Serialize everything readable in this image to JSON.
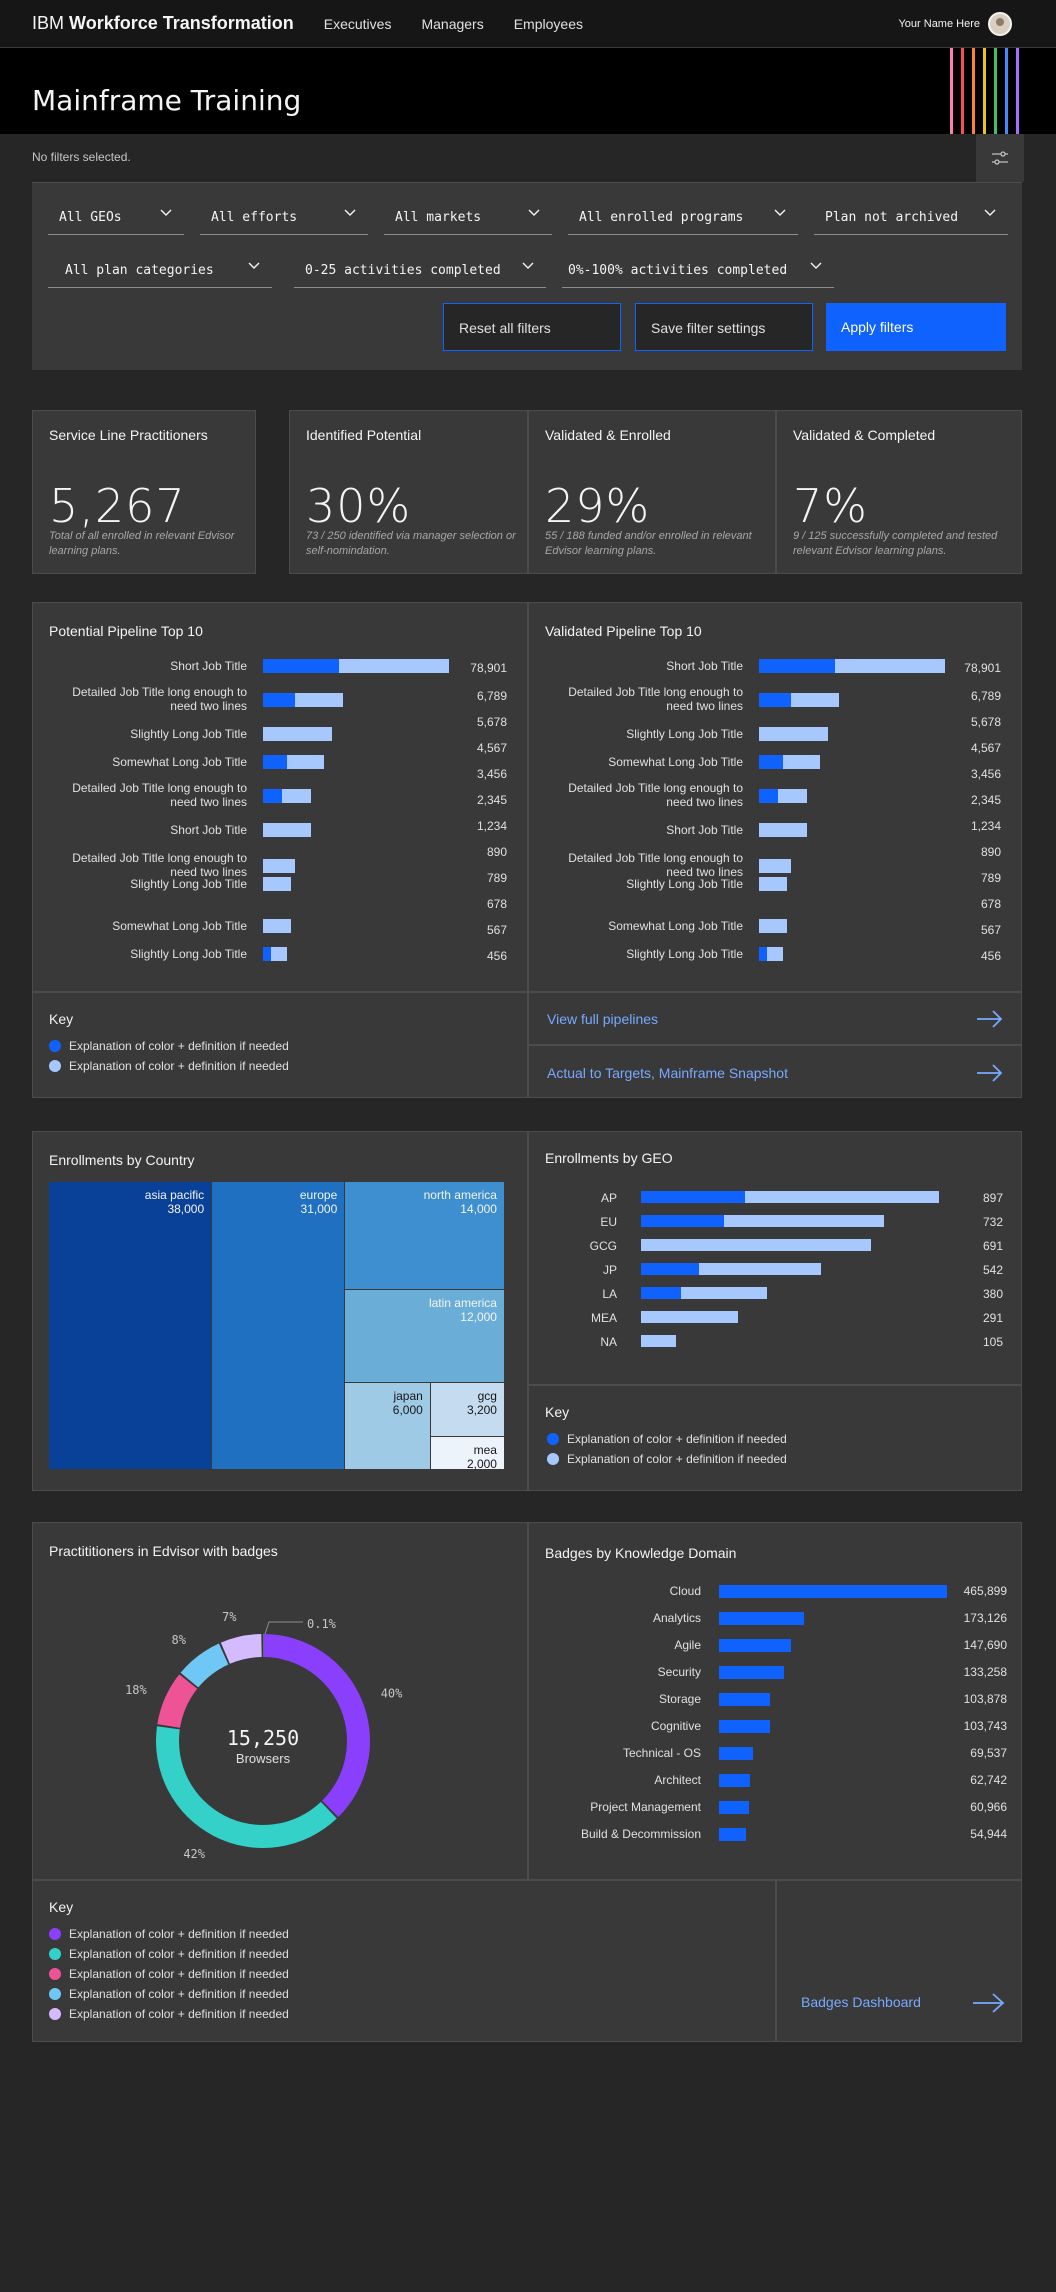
{
  "app": {
    "brand_prefix": "IBM",
    "brand_name": "Workforce Transformation"
  },
  "nav": {
    "items": [
      "Executives",
      "Managers",
      "Employees"
    ]
  },
  "user": {
    "name": "Your Name Here"
  },
  "page": {
    "title": "Mainframe Training",
    "stripe_colors": [
      "#ff7eb6",
      "#fa4d56",
      "#ff832b",
      "#f1c21b",
      "#42be65",
      "#4589ff",
      "#a56eff"
    ]
  },
  "filters": {
    "status": "No filters selected.",
    "dropdowns_row1": [
      "All GEOs",
      "All efforts",
      "All markets",
      "All enrolled programs",
      "Plan not archived"
    ],
    "dropdowns_row2": [
      "All plan categories",
      "0-25 activities completed",
      "0%-100% activities completed"
    ],
    "reset_label": "Reset all filters",
    "save_label": "Save filter settings",
    "apply_label": "Apply filters"
  },
  "kpis": [
    {
      "title": "Service Line Practitioners",
      "value": "5,267",
      "note": "Total of all enrolled in relevant Edvisor learning plans."
    },
    {
      "title": "Identified Potential",
      "value": "30%",
      "note": "73 / 250 identified via manager selection or self-nomindation."
    },
    {
      "title": "Validated & Enrolled",
      "value": "29%",
      "note": "55 / 188 funded and/or enrolled in relevant Edvisor learning plans."
    },
    {
      "title": "Validated & Completed",
      "value": "7%",
      "note": "9 / 125 successfully completed and tested relevant Edvisor learning plans."
    }
  ],
  "pipelines": {
    "potential_title": "Potential Pipeline Top 10",
    "validated_title": "Validated Pipeline Top 10",
    "labels": [
      "Short Job Title",
      "Detailed Job Title long enough to need two lines",
      "Slightly Long Job Title",
      "Somewhat Long Job Title",
      "Detailed Job Title long enough to need two lines",
      "Short Job Title",
      "Detailed Job Title long enough to need two lines",
      "Slightly Long Job Title",
      "Somewhat Long Job Title",
      "Slightly Long Job Title"
    ],
    "values": [
      "78,901",
      "6,789",
      "5,678",
      "4,567",
      "3,456",
      "2,345",
      "1,234",
      "890",
      "789",
      "678",
      "567",
      "456"
    ],
    "dark_fraction": [
      0.41,
      0.4,
      0,
      0.39,
      0.39,
      0,
      0,
      0,
      0,
      0.33
    ],
    "bar_fraction": [
      1,
      0.43,
      0.37,
      0.33,
      0.26,
      0.26,
      0.17,
      0.15,
      0.15,
      0.13
    ]
  },
  "key": {
    "title": "Key",
    "two_items": [
      "Explanation of color + definition if needed",
      "Explanation of color + definition if needed"
    ],
    "colors_two": [
      "#0f62fe",
      "#a6c8ff"
    ]
  },
  "links": {
    "full_pipelines": "View full pipelines",
    "snapshot": "Actual to Targets, Mainframe Snapshot",
    "badges_dashboard": "Badges Dashboard"
  },
  "country": {
    "title": "Enrollments by Country",
    "cells": [
      {
        "name": "asia pacific",
        "value": "38,000",
        "color": "#0a4198"
      },
      {
        "name": "europe",
        "value": "31,000",
        "color": "#1f70c1"
      },
      {
        "name": "north america",
        "value": "14,000",
        "color": "#3d8fd0"
      },
      {
        "name": "latin america",
        "value": "12,000",
        "color": "#6aaed8"
      },
      {
        "name": "japan",
        "value": "6,000",
        "color": "#9ecae6"
      },
      {
        "name": "gcg",
        "value": "3,200",
        "color": "#c5dcf0"
      },
      {
        "name": "mea",
        "value": "2,000",
        "color": "#edf3fb"
      }
    ]
  },
  "geo": {
    "title": "Enrollments by GEO",
    "rows": [
      {
        "label": "AP",
        "value": "897",
        "total": 897,
        "dark": 0.35
      },
      {
        "label": "EU",
        "value": "732",
        "total": 732,
        "dark": 0.34
      },
      {
        "label": "GCG",
        "value": "691",
        "total": 691,
        "dark": 0
      },
      {
        "label": "JP",
        "value": "542",
        "total": 542,
        "dark": 0.32
      },
      {
        "label": "LA",
        "value": "380",
        "total": 380,
        "dark": 0.32
      },
      {
        "label": "MEA",
        "value": "291",
        "total": 291,
        "dark": 0
      },
      {
        "label": "NA",
        "value": "105",
        "total": 105,
        "dark": 0
      }
    ]
  },
  "badges": {
    "donut_title": "Practititioners in Edvisor with badges",
    "center_value": "15,250",
    "center_label": "Browsers",
    "slices": [
      {
        "label": "40%",
        "value": 40,
        "color": "#8a3ffc"
      },
      {
        "label": "42%",
        "value": 42,
        "color": "#33d1c8"
      },
      {
        "label": "18%",
        "value": 9,
        "color": "#ee5396"
      },
      {
        "label": "8%",
        "value": 8,
        "color": "#6fc7f5"
      },
      {
        "label": "7%",
        "value": 6.9,
        "color": "#d4bbff"
      },
      {
        "label": "0.1%",
        "value": 0.1,
        "color": "#9ef0f0"
      }
    ],
    "domain_title": "Badges by Knowledge Domain",
    "domains": [
      {
        "label": "Cloud",
        "value": "465,899",
        "num": 465899
      },
      {
        "label": "Analytics",
        "value": "173,126",
        "num": 173126
      },
      {
        "label": "Agile",
        "value": "147,690",
        "num": 147690
      },
      {
        "label": "Security",
        "value": "133,258",
        "num": 133258
      },
      {
        "label": "Storage",
        "value": "103,878",
        "num": 103878
      },
      {
        "label": "Cognitive",
        "value": "103,743",
        "num": 103743
      },
      {
        "label": "Technical - OS",
        "value": "69,537",
        "num": 69537
      },
      {
        "label": "Architect",
        "value": "62,742",
        "num": 62742
      },
      {
        "label": "Project Management",
        "value": "60,966",
        "num": 60966
      },
      {
        "label": "Build & Decommission",
        "value": "54,944",
        "num": 54944
      }
    ],
    "key_items": [
      "Explanation of color + definition if needed",
      "Explanation of color + definition if needed",
      "Explanation of color + definition if needed",
      "Explanation of color + definition if needed",
      "Explanation of color + definition if needed"
    ],
    "key_colors": [
      "#8a3ffc",
      "#33d1c8",
      "#ee5396",
      "#6fc7f5",
      "#d4bbff"
    ]
  }
}
